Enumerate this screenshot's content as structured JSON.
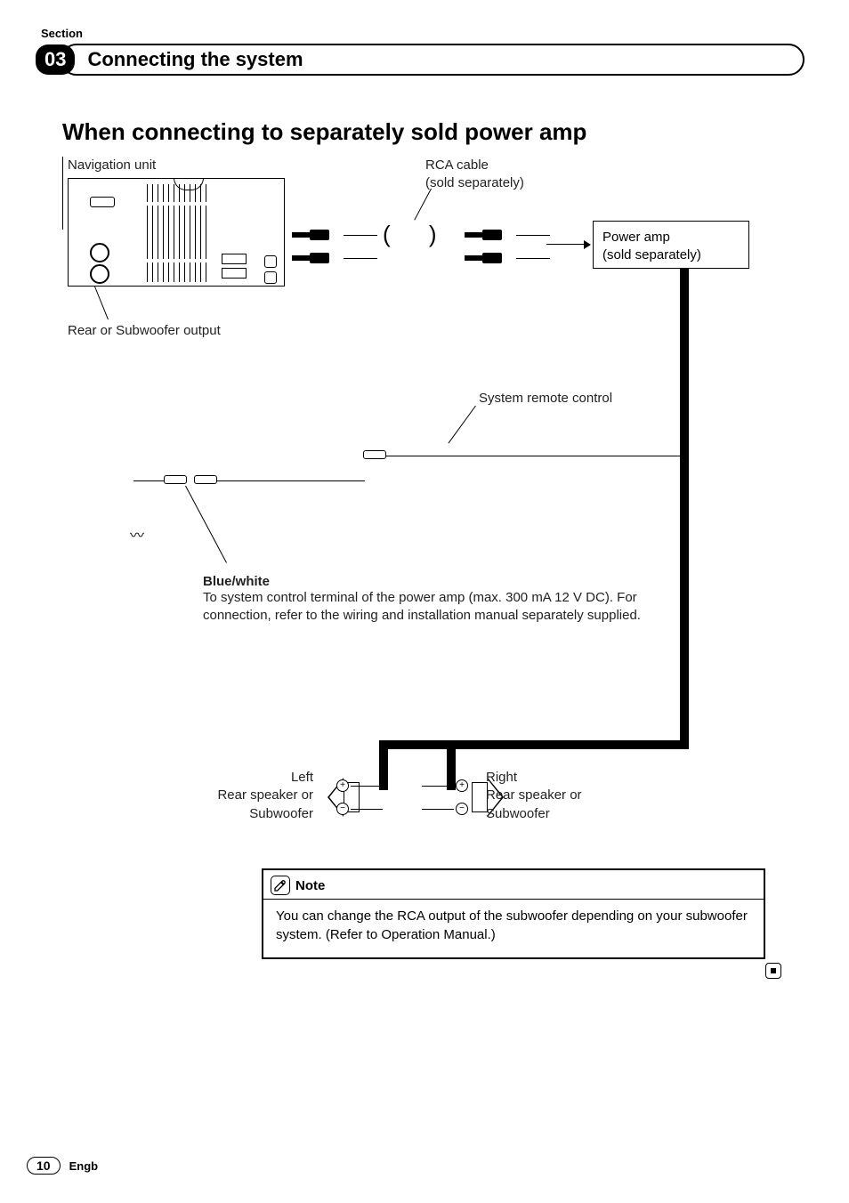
{
  "header": {
    "section_word": "Section",
    "section_number": "03",
    "chapter_title": "Connecting the system"
  },
  "main": {
    "heading": "When connecting to separately sold power amp"
  },
  "diagram": {
    "nav_unit_label": "Navigation unit",
    "rear_sub_output_label": "Rear or Subwoofer output",
    "rca_cable_label": "RCA cable\n(sold separately)",
    "power_amp_label": "Power amp\n(sold separately)",
    "system_remote_label": "System remote control",
    "blue_white_title": "Blue/white",
    "blue_white_desc": "To system control terminal of the power amp (max. 300 mA 12 V DC). For connection, refer to the wiring and installation manual separately supplied.",
    "left_speaker": "Left\nRear speaker or\nSubwoofer",
    "right_speaker": "Right\nRear speaker or\nSubwoofer",
    "plus": "+",
    "minus": "−"
  },
  "note": {
    "title": "Note",
    "body": "You can change the RCA output of the subwoofer depending on your subwoofer system. (Refer to Operation Manual.)"
  },
  "footer": {
    "page_number": "10",
    "language": "Engb"
  }
}
